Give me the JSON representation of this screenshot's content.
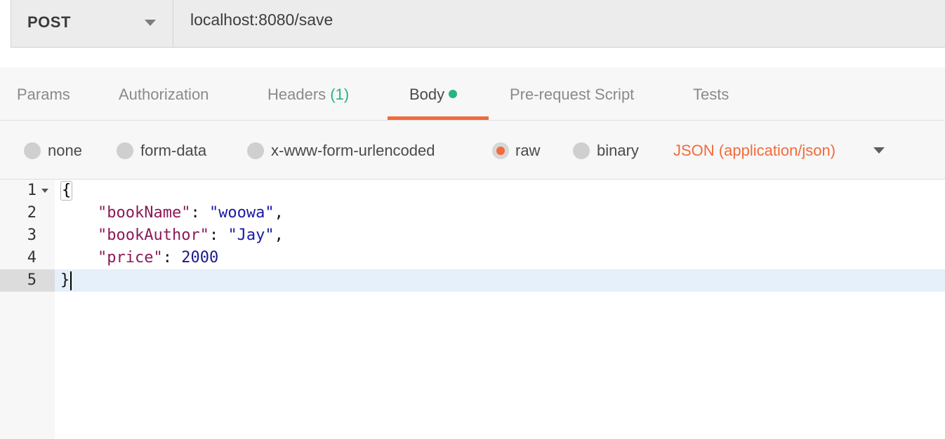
{
  "request": {
    "method": "POST",
    "url": "localhost:8080/save"
  },
  "tabs": [
    {
      "label": "Params"
    },
    {
      "label": "Authorization"
    },
    {
      "label": "Headers",
      "count": "(1)"
    },
    {
      "label": "Body",
      "active": true
    },
    {
      "label": "Pre-request Script"
    },
    {
      "label": "Tests"
    }
  ],
  "body_types": [
    {
      "label": "none",
      "selected": false
    },
    {
      "label": "form-data",
      "selected": false
    },
    {
      "label": "x-www-form-urlencoded",
      "selected": false
    },
    {
      "label": "raw",
      "selected": true
    },
    {
      "label": "binary",
      "selected": false
    }
  ],
  "content_type": "JSON (application/json)",
  "editor": {
    "line_numbers": [
      "1",
      "2",
      "3",
      "4",
      "5"
    ],
    "lines": {
      "l1": {
        "open": "{"
      },
      "l2": {
        "key": "\"bookName\"",
        "colon": ": ",
        "value": "\"woowa\"",
        "comma": ","
      },
      "l3": {
        "key": "\"bookAuthor\"",
        "colon": ": ",
        "value": "\"Jay\"",
        "comma": ","
      },
      "l4": {
        "key": "\"price\"",
        "colon": ": ",
        "value": "2000"
      },
      "l5": {
        "close": "}"
      }
    }
  },
  "colors": {
    "accent": "#f26b3a",
    "success": "#26b47f",
    "json_key": "#8b1a57",
    "json_string": "#1a1aa6"
  }
}
